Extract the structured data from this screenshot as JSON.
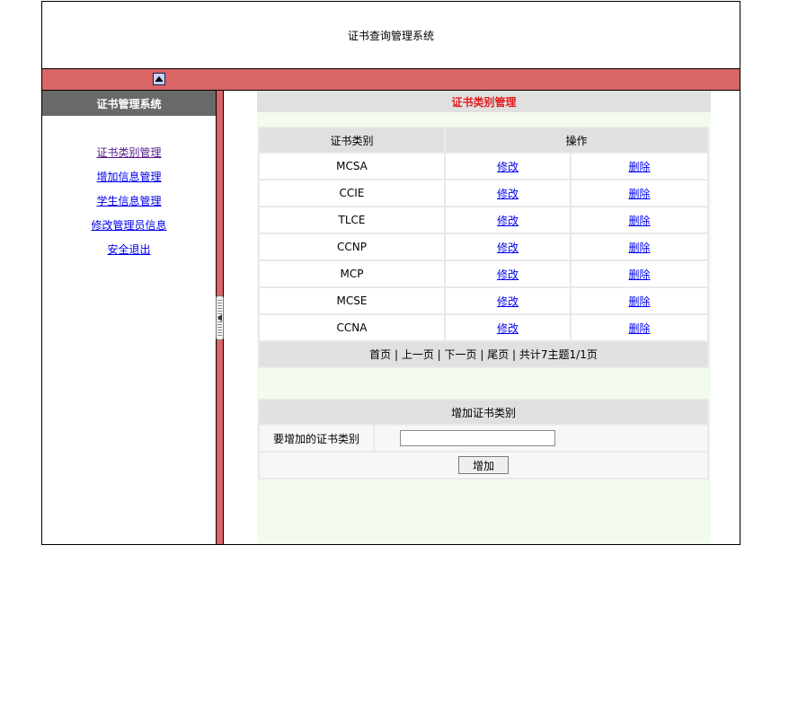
{
  "header": {
    "title": "证书查询管理系统"
  },
  "sidebar": {
    "title": "证书管理系统",
    "items": [
      {
        "label": "证书类别管理"
      },
      {
        "label": "增加信息管理"
      },
      {
        "label": "学生信息管理"
      },
      {
        "label": "修改管理员信息"
      },
      {
        "label": "安全退出"
      }
    ]
  },
  "main": {
    "title": "证书类别管理",
    "table": {
      "headers": {
        "category": "证书类别",
        "action": "操作"
      },
      "rows": [
        {
          "category": "MCSA",
          "edit": "修改",
          "delete": "删除"
        },
        {
          "category": "CCIE",
          "edit": "修改",
          "delete": "删除"
        },
        {
          "category": "TLCE",
          "edit": "修改",
          "delete": "删除"
        },
        {
          "category": "CCNP",
          "edit": "修改",
          "delete": "删除"
        },
        {
          "category": "MCP",
          "edit": "修改",
          "delete": "删除"
        },
        {
          "category": "MCSE",
          "edit": "修改",
          "delete": "删除"
        },
        {
          "category": "CCNA",
          "edit": "修改",
          "delete": "删除"
        }
      ]
    },
    "pager": {
      "first": "首页",
      "prev": "上一页",
      "next": "下一页",
      "last": "尾页",
      "summary": "共计7主题1/1页",
      "separator": " | "
    },
    "add_form": {
      "title": "增加证书类别",
      "field_label": "要增加的证书类别",
      "input_value": "",
      "button_label": "增加"
    }
  },
  "colors": {
    "bar_red": "#d96565",
    "sidebar_header": "#696969",
    "main_title_red": "#e31b1b",
    "content_bg": "#f3faee"
  },
  "icons": {
    "collapse": "collapse-up-icon",
    "splitter": "splitter-handle-icon"
  }
}
